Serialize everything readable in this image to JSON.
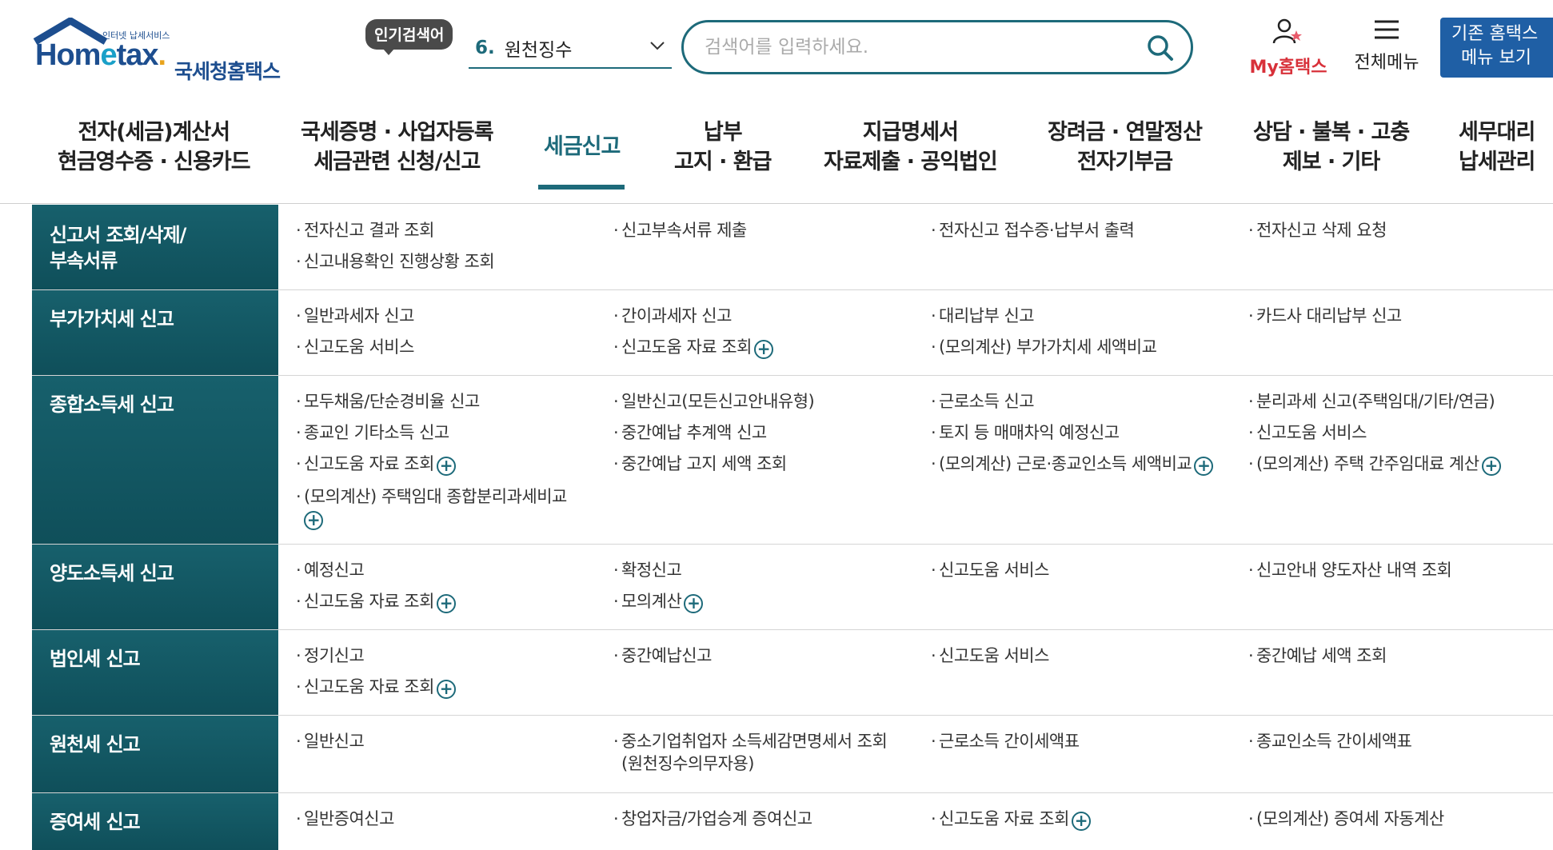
{
  "logo": {
    "tagline": "인터넷 납세서비스",
    "word_a": "Hom",
    "word_e": "e",
    "word_b": "tax",
    "word_dot": ".",
    "name": "국세청홈택스"
  },
  "popular": {
    "badge": "인기검색어",
    "num": "6.",
    "keyword": "원천징수"
  },
  "search": {
    "placeholder": "검색어를 입력하세요."
  },
  "utility": {
    "my": "My홈택스",
    "all_menu": "전체메뉴",
    "old_menu_l1": "기존 홈택스",
    "old_menu_l2": "메뉴 보기"
  },
  "gnb": [
    {
      "l1": "전자(세금)계산서",
      "l2": "현금영수증 · 신용카드"
    },
    {
      "l1": "국세증명 · 사업자등록",
      "l2": "세금관련 신청/신고"
    },
    {
      "l1": "세금신고",
      "l2": ""
    },
    {
      "l1": "납부",
      "l2": "고지 · 환급"
    },
    {
      "l1": "지급명세서",
      "l2": "자료제출 · 공익법인"
    },
    {
      "l1": "장려금 · 연말정산",
      "l2": "전자기부금"
    },
    {
      "l1": "상담 · 불복 · 고충",
      "l2": "제보 · 기타"
    },
    {
      "l1": "세무대리",
      "l2": "납세관리"
    }
  ],
  "rows": [
    {
      "title_l1": "신고서 조회/삭제/",
      "title_l2": "부속서류",
      "links": [
        "전자신고 결과 조회",
        "신고부속서류 제출",
        "전자신고 접수증·납부서 출력",
        "전자신고 삭제 요청",
        "신고내용확인 진행상황 조회"
      ]
    },
    {
      "title": "부가가치세 신고",
      "links": [
        "일반과세자 신고",
        "간이과세자 신고",
        "대리납부 신고",
        "카드사 대리납부 신고",
        "신고도움 서비스",
        "신고도움 자료 조회",
        "(모의계산) 부가가치세 세액비교"
      ]
    },
    {
      "title": "종합소득세 신고",
      "links": [
        "모두채움/단순경비율 신고",
        "일반신고(모든신고안내유형)",
        "근로소득 신고",
        "분리과세 신고(주택임대/기타/연금)",
        "종교인 기타소득 신고",
        "중간예납 추계액 신고",
        "토지 등 매매차익 예정신고",
        "신고도움 서비스",
        "신고도움 자료 조회",
        "중간예납 고지 세액 조회",
        "(모의계산) 근로·종교인소득 세액비교",
        "(모의계산) 주택 간주임대료 계산",
        "(모의계산) 주택임대 종합분리과세비교"
      ]
    },
    {
      "title": "양도소득세 신고",
      "links": [
        "예정신고",
        "확정신고",
        "신고도움 서비스",
        "신고안내 양도자산 내역 조회",
        "신고도움 자료 조회",
        "모의계산"
      ]
    },
    {
      "title": "법인세 신고",
      "links": [
        "정기신고",
        "중간예납신고",
        "신고도움 서비스",
        "중간예납 세액 조회",
        "신고도움 자료 조회"
      ]
    },
    {
      "title": "원천세 신고",
      "links": [
        "일반신고",
        "중소기업취업자 소득세감면명세서 조회",
        "(원천징수의무자용)",
        "근로소득 간이세액표",
        "종교인소득 간이세액표"
      ]
    },
    {
      "title": "증여세 신고",
      "links": [
        "일반증여신고",
        "창업자금/가업승계 증여신고",
        "신고도움 자료 조회",
        "(모의계산) 증여세 자동계산"
      ]
    }
  ],
  "plus_symbol": "+"
}
